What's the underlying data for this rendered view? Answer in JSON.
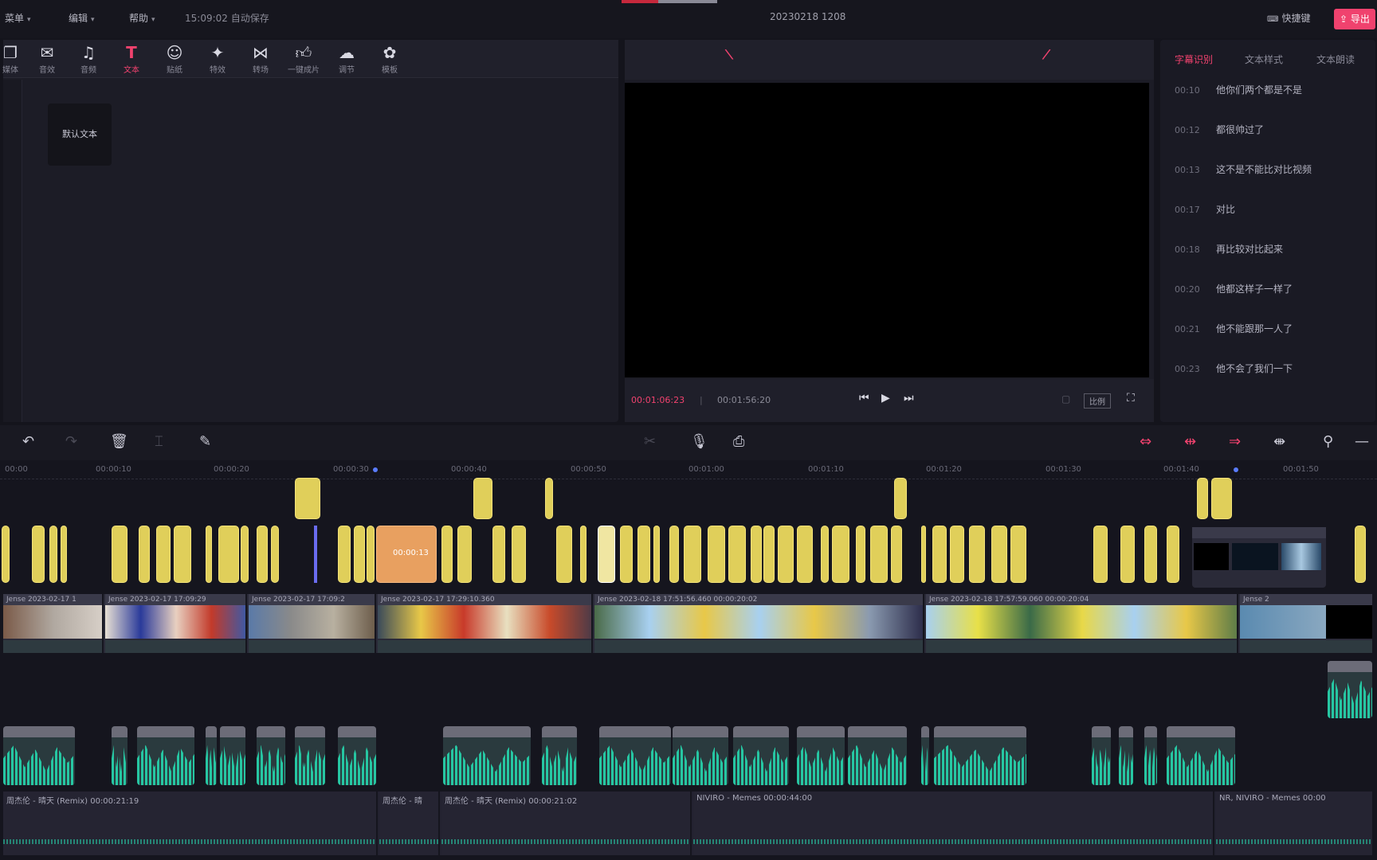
{
  "topbar": {
    "menus": [
      {
        "label": "菜单"
      },
      {
        "label": "编辑"
      },
      {
        "label": "帮助"
      }
    ],
    "autosave": "15:09:02 自动保存",
    "project_title": "20230218 1208",
    "shortcut": "快捷键",
    "export_label": "导出"
  },
  "media": {
    "tools": [
      {
        "icon": "media-icon",
        "label": "媒体"
      },
      {
        "icon": "sound-effect-icon",
        "label": "音效"
      },
      {
        "icon": "audio-icon",
        "label": "音频"
      },
      {
        "icon": "text-icon",
        "label": "文本",
        "active": true
      },
      {
        "icon": "sticker-icon",
        "label": "贴纸"
      },
      {
        "icon": "effect-icon",
        "label": "特效"
      },
      {
        "icon": "transition-icon",
        "label": "转场"
      },
      {
        "icon": "filter-icon",
        "label": "一键成片"
      },
      {
        "icon": "adjust-icon",
        "label": "调节"
      },
      {
        "icon": "template-icon",
        "label": "模板"
      }
    ],
    "default_text": "默认文本"
  },
  "player": {
    "current_time": "00:01:06:23",
    "total_time": "00:01:56:20",
    "ratio": "比例"
  },
  "right_panel": {
    "tabs": [
      {
        "label": "字幕识别",
        "active": true
      },
      {
        "label": "文本样式"
      },
      {
        "label": "文本朗读"
      }
    ],
    "subtitles": [
      {
        "time": "00:10",
        "text": "他你们两个都是不是"
      },
      {
        "time": "00:12",
        "text": "都很帅过了"
      },
      {
        "time": "00:13",
        "text": "这不是不能比对比视频"
      },
      {
        "time": "00:17",
        "text": "对比"
      },
      {
        "time": "00:18",
        "text": "再比较对比起来"
      },
      {
        "time": "00:20",
        "text": "他都这样子一样了"
      },
      {
        "time": "00:21",
        "text": "他不能跟那一人了"
      },
      {
        "time": "00:23",
        "text": "他不会了我们一下"
      }
    ]
  },
  "timeline": {
    "ticks": [
      "00:00",
      "00:00:10",
      "00:00:20",
      "00:00:30",
      "00:00:40",
      "00:00:50",
      "00:01:00",
      "00:01:10",
      "00:01:20",
      "00:01:30",
      "00:01:40",
      "00:01:50"
    ],
    "video_captions": [
      "Jense 2023-02-17 1",
      "Jense 2023-02-17 17:09:29",
      "Jense 2023-02-17 17:09:2",
      "Jense 2023-02-17 17:29:10.360",
      "Jense 2023-02-18 17:51:56.460  00:00:20:02",
      "Jense 2023-02-18 17:57:59.060  00:00:20:04",
      "Jense 2"
    ],
    "music": [
      {
        "label": "周杰伦 - 晴天 (Remix)  00:00:21:19"
      },
      {
        "label": "周杰伦 - 晴"
      },
      {
        "label": "周杰伦 - 晴天 (Remix)  00:00:21:02"
      },
      {
        "label": "NIVIRO - Memes  00:00:44:00"
      },
      {
        "label": "NR, NIVIRO - Memes  00:00"
      }
    ],
    "orange_clip": "00:00:13"
  }
}
